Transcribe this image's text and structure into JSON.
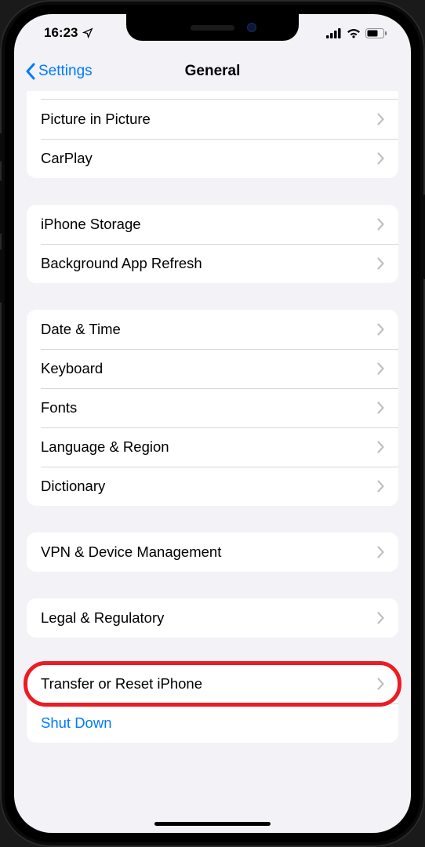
{
  "status": {
    "time": "16:23",
    "location_icon": "location-arrow",
    "cell_bars": 4,
    "wifi": true,
    "battery_pct": 60
  },
  "nav": {
    "back_label": "Settings",
    "title": "General"
  },
  "groups": [
    {
      "id": "g0",
      "truncated_top": true,
      "rows": [
        {
          "id": "pip",
          "label": "Picture in Picture",
          "chevron": true
        },
        {
          "id": "carplay",
          "label": "CarPlay",
          "chevron": true
        }
      ]
    },
    {
      "id": "g1",
      "rows": [
        {
          "id": "storage",
          "label": "iPhone Storage",
          "chevron": true
        },
        {
          "id": "bgr",
          "label": "Background App Refresh",
          "chevron": true
        }
      ]
    },
    {
      "id": "g2",
      "rows": [
        {
          "id": "datetime",
          "label": "Date & Time",
          "chevron": true
        },
        {
          "id": "keyboard",
          "label": "Keyboard",
          "chevron": true
        },
        {
          "id": "fonts",
          "label": "Fonts",
          "chevron": true
        },
        {
          "id": "lang",
          "label": "Language & Region",
          "chevron": true
        },
        {
          "id": "dict",
          "label": "Dictionary",
          "chevron": true
        }
      ]
    },
    {
      "id": "g3",
      "rows": [
        {
          "id": "vpn",
          "label": "VPN & Device Management",
          "chevron": true
        }
      ]
    },
    {
      "id": "g4",
      "rows": [
        {
          "id": "legal",
          "label": "Legal & Regulatory",
          "chevron": true
        }
      ]
    },
    {
      "id": "g5",
      "rows": [
        {
          "id": "reset",
          "label": "Transfer or Reset iPhone",
          "chevron": true,
          "highlighted": true
        },
        {
          "id": "shutdown",
          "label": "Shut Down",
          "chevron": false,
          "link": true
        }
      ]
    }
  ],
  "annotation": {
    "highlight_row_id": "reset",
    "color": "#ec1c24"
  }
}
